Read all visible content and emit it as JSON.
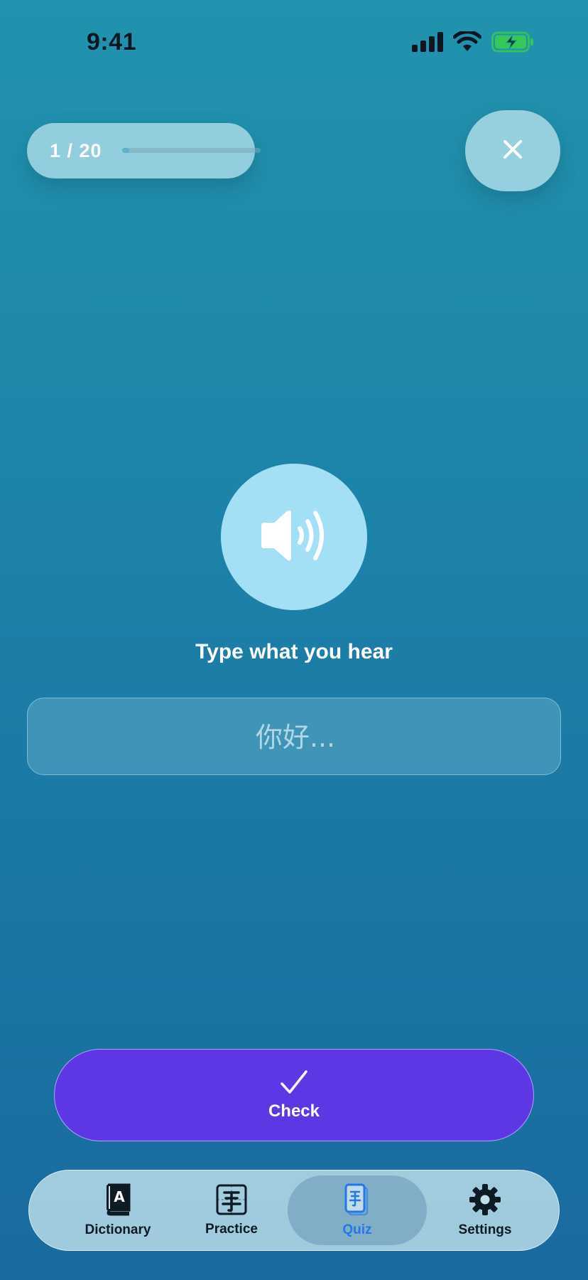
{
  "status_bar": {
    "time": "9:41",
    "icons": [
      "cellular-signal-icon",
      "wifi-icon",
      "battery-charging-icon"
    ]
  },
  "quiz": {
    "progress_text": "1 / 20",
    "progress_fraction": 0.05,
    "close_icon": "close-icon"
  },
  "audio": {
    "icon": "speaker-wave-icon"
  },
  "prompt": "Type what you hear",
  "answer": {
    "value": "",
    "placeholder": "你好..."
  },
  "check_button": {
    "icon": "checkmark-icon",
    "label": "Check",
    "color": "#5d37e4"
  },
  "tabs": [
    {
      "label": "Dictionary",
      "icon": "dictionary-book-icon",
      "active": false
    },
    {
      "label": "Practice",
      "icon": "practice-character-icon",
      "active": false
    },
    {
      "label": "Quiz",
      "icon": "quiz-card-icon",
      "active": true
    },
    {
      "label": "Settings",
      "icon": "gear-icon",
      "active": false
    }
  ],
  "colors": {
    "accent_active_tab": "#2378e6",
    "background_top": "#2193ae",
    "background_bottom": "#1a6aa0"
  }
}
